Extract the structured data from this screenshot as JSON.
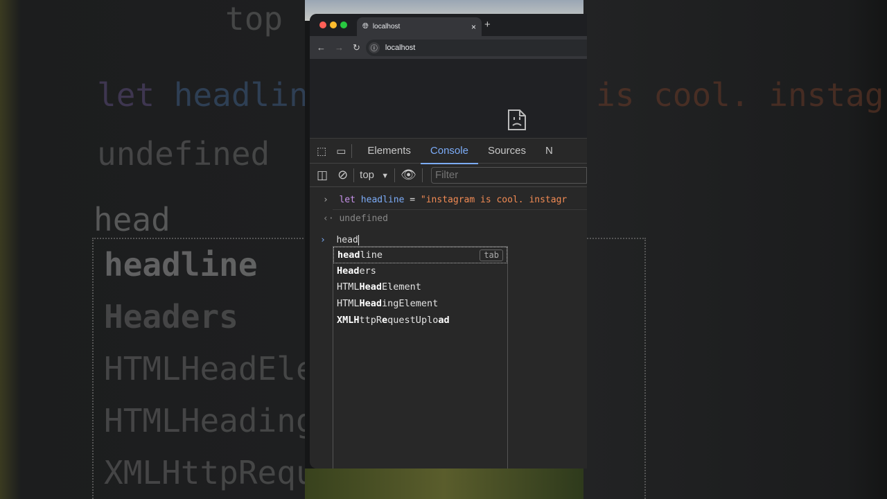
{
  "browser": {
    "tab_title": "localhost",
    "tab_close": "×",
    "new_tab": "+",
    "url": "localhost"
  },
  "devtools": {
    "tabs": [
      "Elements",
      "Console",
      "Sources",
      "N"
    ],
    "context": "top",
    "filter_placeholder": "Filter"
  },
  "console": {
    "lines": [
      {
        "keyword": "let",
        "ident": "headline",
        "op": "=",
        "string": "\"instagram is cool. instagr"
      },
      {
        "result": "undefined"
      }
    ],
    "input": "head",
    "autocomplete": {
      "tab_hint": "tab",
      "items": [
        [
          [
            "headline"
          ],
          [
            "head",
            "line"
          ]
        ],
        [
          [
            "Headers"
          ],
          [
            "Head",
            "ers"
          ]
        ],
        [
          [
            "HTMLHeadElement"
          ],
          [
            "HTML",
            "Head",
            "Element"
          ]
        ],
        [
          [
            "HTMLHeadingElement"
          ],
          [
            "HTML",
            "Head",
            "ingElement"
          ]
        ],
        [
          [
            "XMLHttpRequestUpload"
          ],
          [
            "XMLH",
            "ttpR",
            "e",
            "questUplo",
            "ad"
          ]
        ]
      ]
    }
  },
  "echo": {
    "line1": "let headline = \"instagram is cool. instagr",
    "line2": "undefined",
    "top": "top"
  },
  "colors": {
    "accent": "#7cacf8",
    "keyword": "#c792ea",
    "ident": "#7cacf8",
    "string": "#f28b54"
  }
}
